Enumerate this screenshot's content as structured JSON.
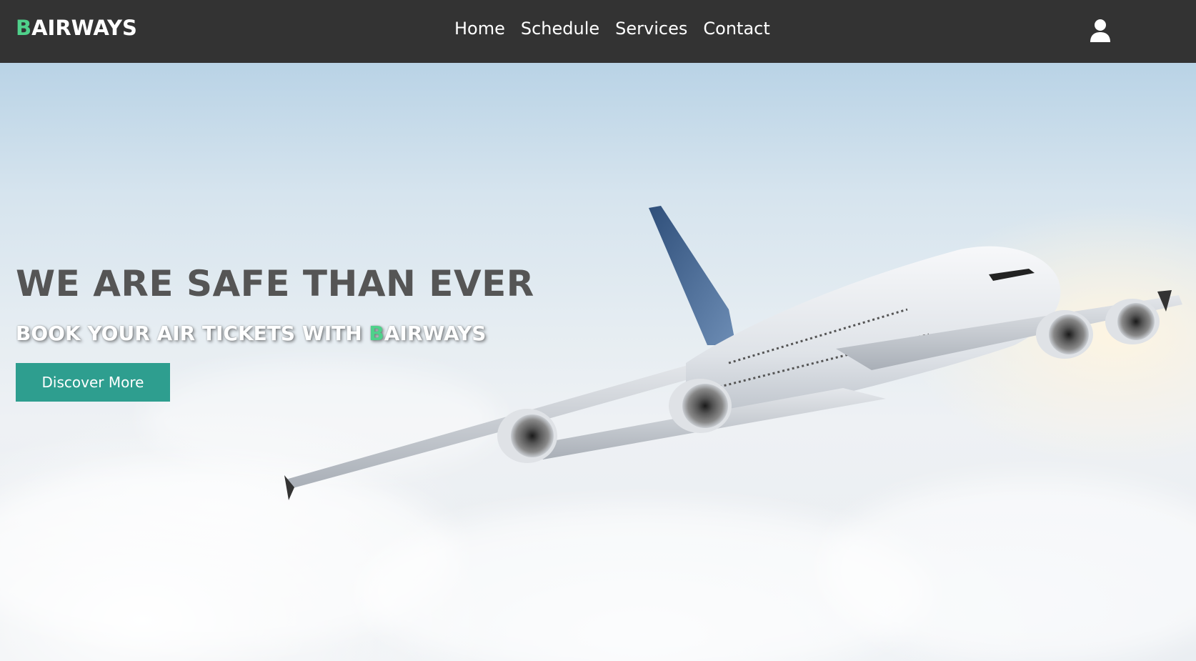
{
  "brand": {
    "accent_letter": "B",
    "rest": "AIRWAYS",
    "accent_color": "#4fd18b"
  },
  "nav": {
    "links": [
      "Home",
      "Schedule",
      "Services",
      "Contact"
    ],
    "user_icon": "user-icon"
  },
  "hero": {
    "title": "WE ARE SAFE THAN EVER",
    "subtitle_prefix": "BOOK YOUR AIR TICKETS WITH ",
    "subtitle_accent": "B",
    "subtitle_suffix": "AIRWAYS",
    "cta_label": "Discover More"
  },
  "colors": {
    "navbar": "#333333",
    "button": "#2e9e8f",
    "title": "#555555"
  }
}
